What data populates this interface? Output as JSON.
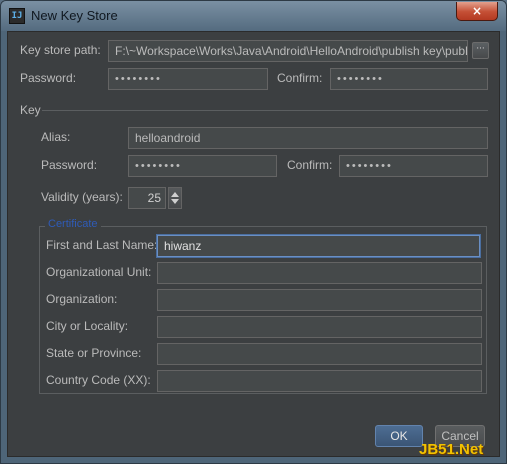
{
  "window": {
    "title": "New Key Store",
    "icon_name": "intellij-idea-icon",
    "close_glyph": "×"
  },
  "keystore": {
    "path_label": "Key store path:",
    "path_value": "F:\\~Workspace\\Works\\Java\\Android\\HelloAndroid\\publish key\\pubkey",
    "browse_glyph": "···",
    "password_label": "Password:",
    "password_value": "••••••••",
    "confirm_label": "Confirm:",
    "confirm_value": "••••••••"
  },
  "key": {
    "section_label": "Key",
    "alias_label": "Alias:",
    "alias_value": "helloandroid",
    "password_label": "Password:",
    "password_value": "••••••••",
    "confirm_label": "Confirm:",
    "confirm_value": "••••••••",
    "validity_label": "Validity (years):",
    "validity_value": "25"
  },
  "certificate": {
    "section_label": "Certificate",
    "fields": [
      {
        "label": "First and Last Name:",
        "value": "hiwanz"
      },
      {
        "label": "Organizational Unit:",
        "value": ""
      },
      {
        "label": "Organization:",
        "value": ""
      },
      {
        "label": "City or Locality:",
        "value": ""
      },
      {
        "label": "State or Province:",
        "value": ""
      },
      {
        "label": "Country Code (XX):",
        "value": ""
      }
    ]
  },
  "buttons": {
    "ok_label": "OK",
    "cancel_label": "Cancel"
  },
  "watermark": {
    "text": "JB51.Net"
  },
  "colors": {
    "dialog_bg": "#3c3f41",
    "field_bg": "#45494a",
    "accent": "#6a8fc3",
    "legend": "#2f5bb7"
  }
}
